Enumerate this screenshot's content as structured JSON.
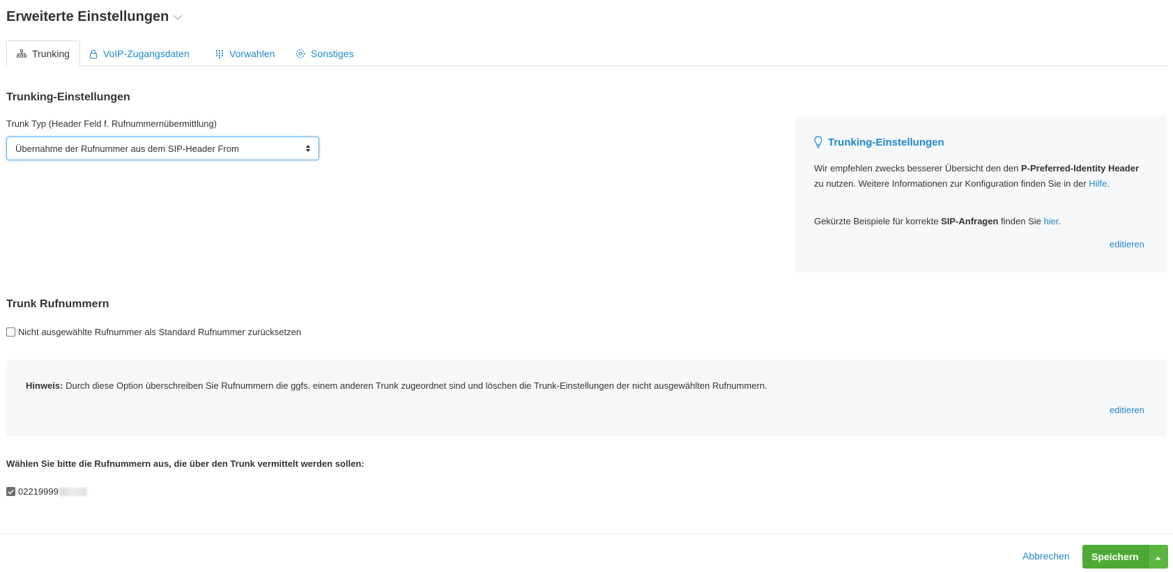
{
  "page": {
    "title": "Erweiterte Einstellungen"
  },
  "tabs": [
    {
      "label": "Trunking",
      "icon": "sitemap-icon",
      "active": true
    },
    {
      "label": "VoIP-Zugangsdaten",
      "icon": "lock-icon",
      "active": false
    },
    {
      "label": "Vorwahlen",
      "icon": "keypad-icon",
      "active": false
    },
    {
      "label": "Sonstiges",
      "icon": "gear-icon",
      "active": false
    }
  ],
  "trunking": {
    "heading": "Trunking-Einstellungen",
    "field_label": "Trunk Typ (Header Feld f. Rufnummernübermittlung)",
    "select_value": "Übernahme der Rufnummer aus dem SIP-Header From"
  },
  "info_panel": {
    "title": "Trunking-Einstellungen",
    "icon": "lightbulb-icon",
    "p1_pre": "Wir empfehlen zwecks besserer Übersicht den den ",
    "p1_bold": "P-Preferred-Identity Header",
    "p1_post": " zu nutzen. Weitere Informationen zur Konfiguration finden Sie in der ",
    "p1_link": "Hilfe",
    "p1_end": ".",
    "p2_pre": "Gekürzte Beispiele für korrekte ",
    "p2_bold": "SIP-Anfragen",
    "p2_mid": " finden Sie ",
    "p2_link": "hier",
    "p2_end": ".",
    "edit": "editieren"
  },
  "numbers": {
    "heading": "Trunk Rufnummern",
    "reset_checkbox_label": "Nicht ausgewählte Rufnummer als Standard Rufnummer zurücksetzen",
    "reset_checked": false,
    "hint_bold": "Hinweis:",
    "hint_text": " Durch diese Option überschreiben Sie Rufnummern die ggfs. einem anderen Trunk zugeordnet sind und löschen die Trunk-Einstellungen der nicht ausgewählten Rufnummern.",
    "hint_edit": "editieren",
    "choose_label": "Wählen Sie bitte die Rufnummern aus, die über den Trunk vermittelt werden sollen:",
    "items": [
      {
        "number": "02219999",
        "checked": true
      }
    ]
  },
  "footer": {
    "cancel": "Abbrechen",
    "save": "Speichern"
  },
  "colors": {
    "link": "#1e88c7",
    "save_green": "#4ea934",
    "panel_bg": "#f6f7f9"
  }
}
